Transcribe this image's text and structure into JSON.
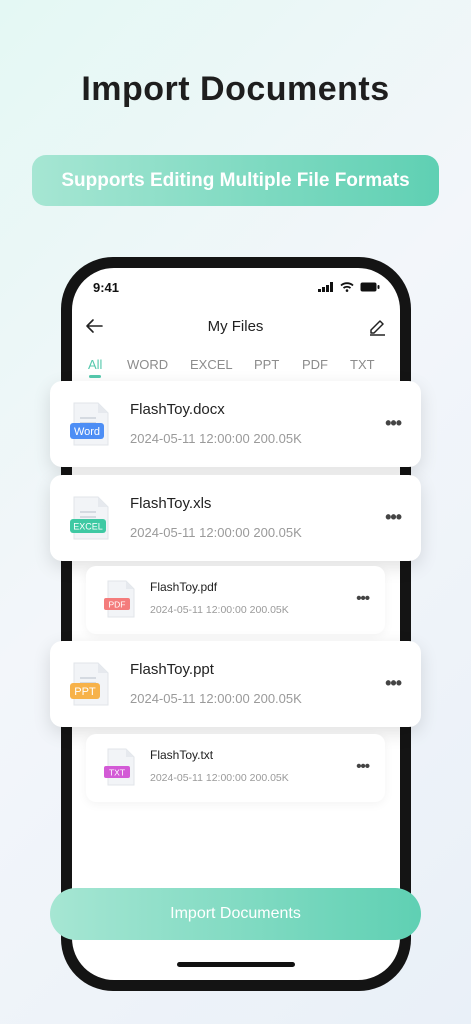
{
  "headline": "Import Documents",
  "subheadline": "Supports Editing Multiple File Formats",
  "status_bar": {
    "time": "9:41"
  },
  "nav": {
    "title": "My Files"
  },
  "tabs": [
    "All",
    "WORD",
    "EXCEL",
    "PPT",
    "PDF",
    "TXT"
  ],
  "active_tab": "All",
  "files": [
    {
      "name": "FlashToy.docx",
      "meta": "2024-05-11 12:00:00 200.05K",
      "type_label": "Word",
      "color": "#4d8ef5"
    },
    {
      "name": "FlashToy.xls",
      "meta": "2024-05-11 12:00:00 200.05K",
      "type_label": "EXCEL",
      "color": "#3fc9a3"
    },
    {
      "name": "FlashToy.pdf",
      "meta": "2024-05-11 12:00:00 200.05K",
      "type_label": "PDF",
      "color": "#f47c7c"
    },
    {
      "name": "FlashToy.ppt",
      "meta": "2024-05-11 12:00:00 200.05K",
      "type_label": "PPT",
      "color": "#f7b24a"
    },
    {
      "name": "FlashToy.txt",
      "meta": "2024-05-11 12:00:00 200.05K",
      "type_label": "TXT",
      "color": "#d35ad6"
    }
  ],
  "more_glyph": "•••",
  "import_button": "Import Documents",
  "colors": {
    "accent": "#55c9ad",
    "accent_light": "#a6e6d3"
  }
}
